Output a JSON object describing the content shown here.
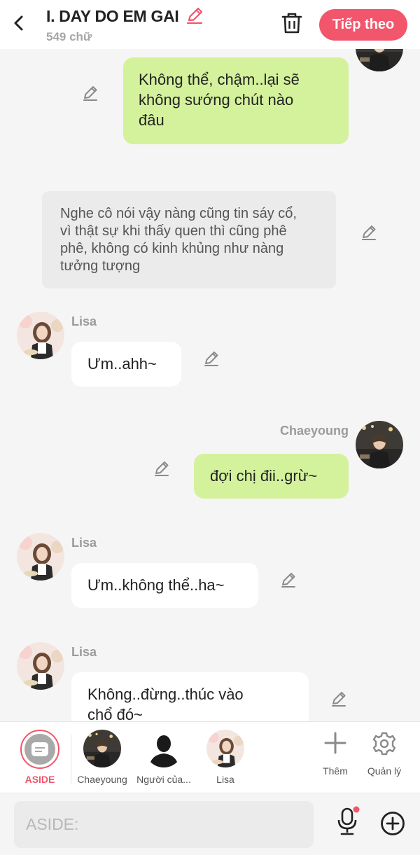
{
  "header": {
    "title": "I. DAY DO EM GAI",
    "word_count": "549 chữ",
    "next_label": "Tiếp theo"
  },
  "colors": {
    "accent": "#f2566c",
    "green_bubble": "#d4f29c",
    "gray_bubble": "#ebebeb"
  },
  "messages": [
    {
      "type": "green",
      "text_lines": [
        "Không thể, chậm..lại sẽ",
        "không sướng chút nào",
        "đâu"
      ]
    },
    {
      "type": "narration",
      "text_lines": [
        "Nghe cô nói vậy nàng cũng tin sáy cổ,",
        "vì thật sự khi thấy quen thì cũng phê",
        "phê, không có kinh khủng như nàng",
        "tưởng tượng"
      ]
    },
    {
      "type": "white",
      "sender": "Lisa",
      "text": "Ưm..ahh~"
    },
    {
      "type": "green",
      "sender": "Chaeyoung",
      "text": "đợi chị đii..grừ~"
    },
    {
      "type": "white",
      "sender": "Lisa",
      "text": "Ưm..không thể..ha~"
    },
    {
      "type": "white",
      "sender": "Lisa",
      "text_lines": [
        "Không..đừng..thúc vào",
        "chổ đó~"
      ]
    }
  ],
  "characters": [
    {
      "label": "ASIDE",
      "active": true,
      "icon": "chat-bubble-icon"
    },
    {
      "label": "Chaeyoung",
      "active": false
    },
    {
      "label": "Người của...",
      "active": false,
      "icon": "person-silhouette-icon"
    },
    {
      "label": "Lisa",
      "active": false
    },
    {
      "label": "Thêm",
      "icon": "plus-icon"
    },
    {
      "label": "Quản lý",
      "icon": "gear-icon"
    }
  ],
  "input": {
    "placeholder": "ASIDE:"
  }
}
